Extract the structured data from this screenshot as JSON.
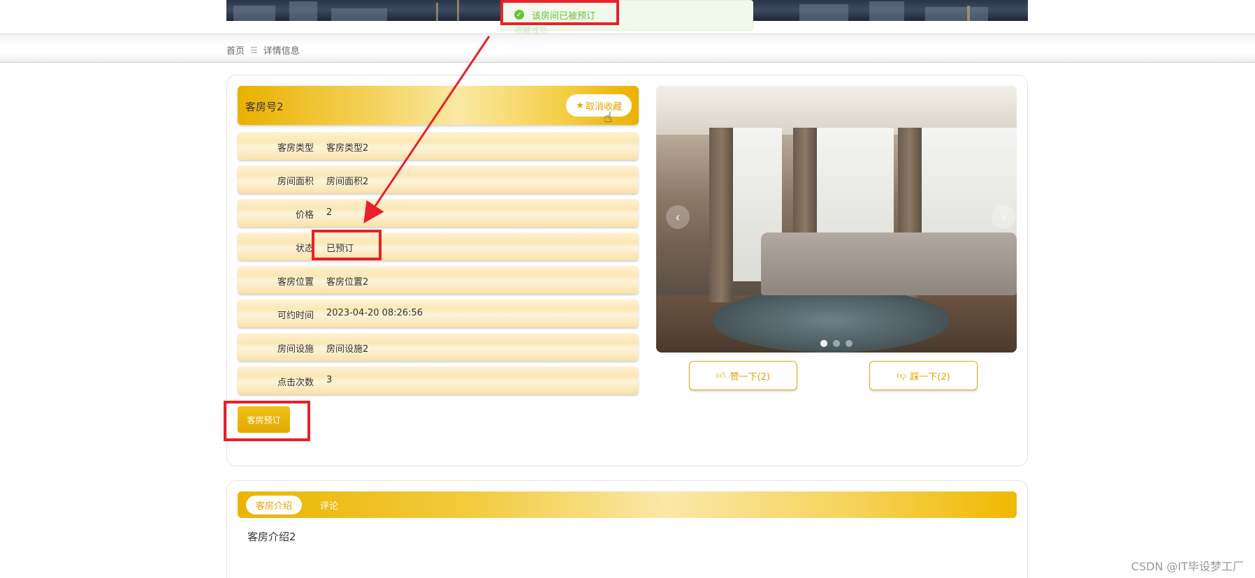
{
  "breadcrumb": {
    "home": "首页",
    "separator": "☰",
    "current": "详情信息"
  },
  "room": {
    "title": "客房号2",
    "favorite_label": "取消收藏",
    "favorite_icon": "star-icon",
    "fields": [
      {
        "key": "客房类型",
        "value": "客房类型2"
      },
      {
        "key": "房间面积",
        "value": "房间面积2"
      },
      {
        "key": "价格",
        "value": "2"
      },
      {
        "key": "状态",
        "value": "已预订"
      },
      {
        "key": "客房位置",
        "value": "客房位置2"
      },
      {
        "key": "可约时间",
        "value": "2023-04-20 08:26:56"
      },
      {
        "key": "房间设施",
        "value": "房间设施2"
      },
      {
        "key": "点击次数",
        "value": "3"
      }
    ],
    "book_label": "客房预订"
  },
  "carousel": {
    "prev": "‹",
    "next": "›",
    "slides": 3,
    "active_slide": 1
  },
  "votes": {
    "like_label": "赞一下(2)",
    "dislike_label": "踩一下(2)"
  },
  "tabs": {
    "intro_label": "客房介绍",
    "comment_label": "评论"
  },
  "intro_text": "客房介绍2",
  "toast": {
    "message": "该房间已被预订",
    "ghost": "收藏成功"
  },
  "watermark": "CSDN @IT毕设梦工厂",
  "colors": {
    "accent": "#e5a300",
    "annotation": "#e8202a",
    "success": "#67c23a"
  }
}
